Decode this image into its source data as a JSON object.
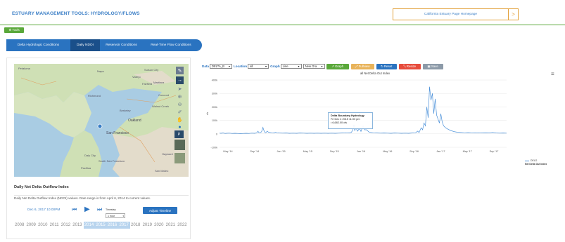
{
  "header": {
    "title": "ESTUARY MANAGEMENT TOOLS: HYDROLOGY/FLOWS",
    "homepage_link": "California Estuary Page Homepage",
    "arrow": ">"
  },
  "tools_label": "⚙ Tools",
  "tabs": [
    {
      "label": "Delta Hydrologic Conditions",
      "active": false
    },
    {
      "label": "Daily NDOI",
      "active": true
    },
    {
      "label": "Reservoir Conditions",
      "active": false
    },
    {
      "label": "Real-Time Flow Conditions",
      "active": false
    }
  ],
  "map": {
    "labels": [
      "Petaluma",
      "Napa",
      "Suisun City",
      "Fairfield",
      "Vallejo",
      "Martinez",
      "Richmond",
      "Concord",
      "Walnut Creek",
      "Berkeley",
      "Oakland",
      "San Francisco",
      "Daly City",
      "Hayward",
      "South San Francisco",
      "Pacifica",
      "San Mateo"
    ],
    "controls": [
      "pencil-icon",
      "arrow-right-icon",
      "cursor-icon",
      "zoom-in-icon",
      "zoom-out-icon",
      "ruler-icon",
      "hand-icon",
      "globe-icon",
      "pdf-icon",
      "layers-icon"
    ]
  },
  "info": {
    "heading": "Daily Net Delta Outflow Index",
    "description": "Daily Net Delta Outflow Index (NDOI) values. Date range is from April 6, 2014 to current values."
  },
  "timeline": {
    "date": "Dec 6, 2017 10:00PM",
    "timestep_label": "Timestep",
    "timestep_value": "1 hour",
    "adjust_label": "Adjust Timeline",
    "years": [
      "2008",
      "2009",
      "2010",
      "2011",
      "2012",
      "2013",
      "2014",
      "2015",
      "2016",
      "2017",
      "2018",
      "2019",
      "2020",
      "2021",
      "2022"
    ],
    "selected_years": [
      "2014",
      "2015",
      "2016",
      "2017"
    ]
  },
  "controls": {
    "data_label": "Data",
    "data_value": "DELTA_B",
    "location_label": "Location",
    "location_value": "all",
    "graph_label": "Graph",
    "graph_value": "Line",
    "graph_option2": "New Gra",
    "btn_graph": "Graph",
    "btn_fullview": "Fullview",
    "btn_reset": "Reset",
    "btn_resize": "Resize",
    "btn_save": "Save"
  },
  "colors": {
    "brand_blue": "#2a73c0",
    "green": "#5aa83a",
    "orange": "#e2a13a",
    "red": "#e74c3c",
    "grey": "#8c9aa8",
    "series": "#4a90d9"
  },
  "tooltip": {
    "title": "Delta Boundary Hydrology",
    "date": "Fri Dec 4 2015 11:00 pm",
    "value": "• 6,682.00 cfs"
  },
  "chart_data": {
    "type": "line",
    "title": "all Net Delta Out Index",
    "xlabel": "",
    "ylabel": "cfs",
    "ylim": [
      -100000,
      400000
    ],
    "yticks": [
      "400k",
      "300k",
      "200k",
      "100k",
      "0",
      "-100k"
    ],
    "xticks": [
      "May '14",
      "Sep '14",
      "Jan '15",
      "May '15",
      "Sep '15",
      "Jan '16",
      "May '16",
      "Sep '16",
      "Jan '17",
      "May '17",
      "Sep '17"
    ],
    "legend": [
      {
        "name": "DELO",
        "subtitle": "Net Delta Out Index"
      }
    ],
    "legend_position": "right",
    "series": [
      {
        "name": "DELO",
        "points": [
          [
            0.0,
            5000
          ],
          [
            0.2,
            4000
          ],
          [
            0.5,
            6000
          ],
          [
            0.8,
            3000
          ],
          [
            1.0,
            4000
          ],
          [
            1.4,
            5000
          ],
          [
            1.8,
            3000
          ],
          [
            2.2,
            4000
          ],
          [
            2.6,
            3000
          ],
          [
            3.0,
            2000
          ],
          [
            3.4,
            3000
          ],
          [
            3.8,
            4000
          ],
          [
            4.2,
            3000
          ],
          [
            4.6,
            5000
          ],
          [
            5.0,
            4000
          ],
          [
            5.3,
            6000
          ],
          [
            5.5,
            20000
          ],
          [
            5.6,
            10000
          ],
          [
            5.8,
            8000
          ],
          [
            6.0,
            15000
          ],
          [
            6.2,
            48000
          ],
          [
            6.3,
            30000
          ],
          [
            6.45,
            12000
          ],
          [
            6.6,
            8000
          ],
          [
            6.8,
            20000
          ],
          [
            7.0,
            12000
          ],
          [
            7.2,
            10000
          ],
          [
            7.5,
            8000
          ],
          [
            7.8,
            6000
          ],
          [
            8.0,
            12000
          ],
          [
            8.2,
            8000
          ],
          [
            8.5,
            6000
          ],
          [
            9.0,
            5000
          ],
          [
            9.5,
            6000
          ],
          [
            10.0,
            4000
          ],
          [
            10.5,
            5000
          ],
          [
            11.0,
            4000
          ],
          [
            11.5,
            6000
          ],
          [
            12.0,
            5000
          ],
          [
            12.5,
            4000
          ],
          [
            13.0,
            5000
          ],
          [
            13.5,
            4000
          ],
          [
            14.0,
            5000
          ],
          [
            14.5,
            4000
          ],
          [
            15.0,
            5000
          ],
          [
            15.5,
            4000
          ],
          [
            16.0,
            5000
          ],
          [
            16.5,
            4000
          ],
          [
            17.0,
            5000
          ],
          [
            17.5,
            6000
          ],
          [
            18.0,
            8000
          ],
          [
            18.5,
            6000
          ],
          [
            18.8,
            10000
          ],
          [
            19.0,
            25000
          ],
          [
            19.2,
            60000
          ],
          [
            19.3,
            25000
          ],
          [
            19.5,
            45000
          ],
          [
            19.7,
            20000
          ],
          [
            20.0,
            40000
          ],
          [
            20.2,
            18000
          ],
          [
            20.5,
            60000
          ],
          [
            20.7,
            30000
          ],
          [
            21.0,
            30000
          ],
          [
            21.3,
            15000
          ],
          [
            21.6,
            10000
          ],
          [
            22.0,
            8000
          ],
          [
            22.5,
            6000
          ],
          [
            23.0,
            5000
          ],
          [
            23.5,
            6000
          ],
          [
            24.0,
            5000
          ],
          [
            24.5,
            4000
          ],
          [
            25.0,
            6000
          ],
          [
            25.5,
            5000
          ],
          [
            26.0,
            4000
          ],
          [
            26.5,
            5000
          ],
          [
            27.0,
            4000
          ],
          [
            27.5,
            6000
          ],
          [
            28.0,
            8000
          ],
          [
            28.3,
            20000
          ],
          [
            28.5,
            10000
          ],
          [
            28.8,
            45000
          ],
          [
            29.0,
            30000
          ],
          [
            29.2,
            80000
          ],
          [
            29.4,
            60000
          ],
          [
            29.6,
            200000
          ],
          [
            29.8,
            120000
          ],
          [
            30.0,
            350000
          ],
          [
            30.2,
            250000
          ],
          [
            30.4,
            300000
          ],
          [
            30.6,
            150000
          ],
          [
            30.8,
            260000
          ],
          [
            31.0,
            140000
          ],
          [
            31.2,
            110000
          ],
          [
            31.4,
            80000
          ],
          [
            31.6,
            150000
          ],
          [
            31.8,
            90000
          ],
          [
            32.0,
            60000
          ],
          [
            32.3,
            45000
          ],
          [
            32.6,
            35000
          ],
          [
            33.0,
            25000
          ],
          [
            33.3,
            20000
          ],
          [
            33.6,
            15000
          ],
          [
            34.0,
            12000
          ],
          [
            34.5,
            10000
          ],
          [
            35.0,
            8000
          ],
          [
            35.5,
            9000
          ],
          [
            36.0,
            8000
          ],
          [
            36.5,
            7000
          ],
          [
            37.0,
            8000
          ],
          [
            37.5,
            6000
          ],
          [
            38.0,
            7000
          ],
          [
            38.5,
            6000
          ],
          [
            39.0,
            10000
          ],
          [
            39.5,
            6000
          ],
          [
            40.0,
            5000
          ],
          [
            40.5,
            6000
          ],
          [
            41.0,
            5000
          ]
        ]
      }
    ]
  }
}
